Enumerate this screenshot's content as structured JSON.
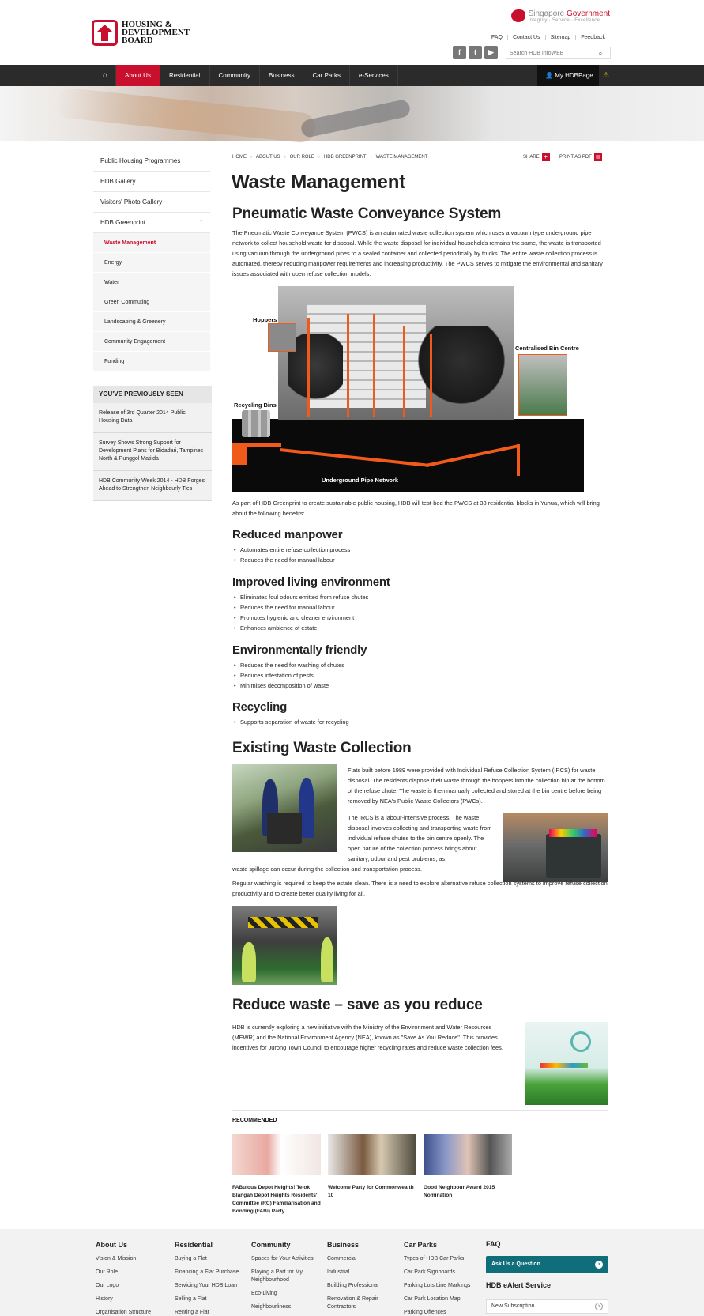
{
  "header": {
    "logo_text": "HOUSING &\nDEVELOPMENT\nBOARD",
    "gov_label": "Singapore",
    "gov_label_accent": "Government",
    "gov_tagline": "Integrity · Service · Excellence",
    "util_links": [
      "FAQ",
      "Contact Us",
      "Sitemap",
      "Feedback"
    ],
    "search_placeholder": "Search HDB InfoWEB",
    "social": [
      "f",
      "t",
      "▶"
    ]
  },
  "nav": {
    "items": [
      "About Us",
      "Residential",
      "Community",
      "Business",
      "Car Parks",
      "e-Services"
    ],
    "active": "About Us",
    "my_page": "My HDBPage"
  },
  "sidebar": {
    "items": [
      "Public Housing Programmes",
      "HDB Gallery",
      "Visitors' Photo Gallery",
      "HDB Greenprint"
    ],
    "sub_items": [
      "Waste Management",
      "Energy",
      "Water",
      "Green Commuting",
      "Landscaping & Greenery",
      "Community Engagement",
      "Funding"
    ],
    "previously_seen_title": "YOU'VE PREVIOUSLY SEEN",
    "previously_seen": [
      "Release of 3rd Quarter 2014 Public Housing Data",
      "Survey Shows Strong Support for Development Plans for Bidadari, Tampines North & Punggol Matilda",
      "HDB Community Week 2014 - HDB Forges Ahead to Strengthen Neighbourly Ties"
    ]
  },
  "breadcrumb": [
    "HOME",
    "ABOUT US",
    "OUR ROLE",
    "HDB GREENPRINT",
    "WASTE MANAGEMENT"
  ],
  "share_label": "SHARE",
  "print_label": "PRINT AS PDF",
  "page_title": "Waste Management",
  "section1": {
    "title": "Pneumatic Waste Conveyance System",
    "body": "The Pneumatic Waste Conveyance System (PWCS) is an automated waste collection system which uses a vacuum type underground pipe network to collect household waste for disposal. While the waste disposal for individual households remains the same, the waste is transported using vacuum through the underground pipes to a sealed container and collected periodically by trucks. The entire waste collection process is automated, thereby reducing manpower requirements and increasing productivity. The PWCS serves to mitigate the environmental and sanitary issues associated with open refuse collection models."
  },
  "diagram_labels": {
    "hoppers": "Hoppers",
    "centralised": "Centralised Bin Centre",
    "recycling": "Recycling Bins",
    "pipe": "Underground Pipe Network"
  },
  "intro2": "As part of HDB Greenprint to create sustainable public housing, HDB will test-bed the PWCS at 38 residential blocks in Yuhua, which will bring about the following benefits:",
  "benefits": [
    {
      "title": "Reduced manpower",
      "items": [
        "Automates entire refuse collection process",
        "Reduces the need for manual labour"
      ]
    },
    {
      "title": "Improved living environment",
      "items": [
        "Eliminates foul odours emitted from refuse chutes",
        "Reduces the need for manual labour",
        "Promotes hygienic and cleaner environment",
        "Enhances ambience of estate"
      ]
    },
    {
      "title": "Environmentally friendly",
      "items": [
        "Reduces the need for washing of chutes",
        "Reduces infestation of pests",
        "Minimises decomposition of waste"
      ]
    },
    {
      "title": "Recycling",
      "items": [
        "Supports separation of waste for recycling"
      ]
    }
  ],
  "section2": {
    "title": "Existing Waste Collection",
    "p1": "Flats built before 1989 were provided with Individual Refuse Collection System (IRCS) for waste disposal. The residents dispose their waste through the hoppers into the collection bin at the bottom of the refuse chute. The waste is then manually collected and stored at the bin centre before being removed by NEA's Public Waste Collectors (PWCs).",
    "p2": "The IRCS is a labour-intensive process. The waste disposal involves collecting and transporting waste from individual refuse chutes to the bin centre openly. The open nature of the collection process brings about sanitary, odour and pest problems, as",
    "p2b": "waste spillage can occur during the collection and transportation process.",
    "p3": "Regular washing is required to keep the estate clean. There is a need to explore alternative refuse collection systems to improve refuse collection productivity and to create better quality living for all."
  },
  "section3": {
    "title": "Reduce waste – save as you reduce",
    "body": "HDB is currently exploring a new initiative with the Ministry of the Environment and Water Resources (MEWR) and the National Environment Agency (NEA), known as \"Save As You Reduce\". This provides incentives for Jurong Town Council to encourage higher recycling rates and reduce waste collection fees."
  },
  "recommended": {
    "title": "RECOMMENDED",
    "cards": [
      "FABulous Depot Heights! Telok Blangah Depot Heights Residents' Committee (RC) Familiarisation and Bonding (FABi) Party",
      "Welcome Party for Commonwealth 10",
      "Good Neighbour Award 2015 Nomination"
    ]
  },
  "footer": {
    "cols": [
      {
        "title": "About Us",
        "links": [
          "Vision & Mission",
          "Our Role",
          "Our Logo",
          "History",
          "Organisation Structure"
        ]
      },
      {
        "title": "Residential",
        "links": [
          "Buying a Flat",
          "Financing a Flat Purchase",
          "Servicing Your HDB Loan",
          "Selling a Flat",
          "Renting a Flat"
        ]
      },
      {
        "title": "Community",
        "links": [
          "Spaces for Your Activities",
          "Playing a Part for My Neighbourhood",
          "Eco-Living",
          "Neighbourliness"
        ]
      },
      {
        "title": "Business",
        "links": [
          "Commercial",
          "Industrial",
          "Building Professional",
          "Renovation & Repair Contractors"
        ]
      },
      {
        "title": "Car Parks",
        "links": [
          "Types of HDB Car Parks",
          "Car Park Signboards",
          "Parking Lots Line Markings",
          "Car Park Location Map",
          "Parking Offences"
        ]
      }
    ],
    "faq_title": "FAQ",
    "faq_button": "Ask Us a Question",
    "ealert_title": "HDB eAlert Service",
    "subscription": "New Subscription"
  },
  "colors": {
    "brand_red": "#c8102e",
    "nav_dark": "#2b2b2b",
    "pipe_orange": "#f05a1a",
    "teal": "#0f6e7a"
  }
}
